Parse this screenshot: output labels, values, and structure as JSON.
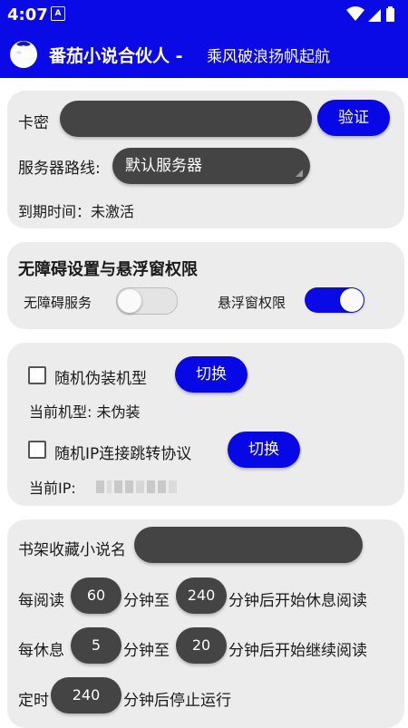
{
  "status": {
    "time": "4:07",
    "notif_icon_label": "A"
  },
  "header": {
    "title": "番茄小说合伙人 -",
    "subtitle": "乘风破浪扬帆起航"
  },
  "card1": {
    "card_key_label": "卡密",
    "card_key_value": "",
    "verify_button": "验证",
    "server_route_label": "服务器路线:",
    "server_route_value": "默认服务器",
    "expire_label": "到期时间：未激活"
  },
  "card2": {
    "title": "无障碍设置与悬浮窗权限",
    "accessibility_label": "无障碍服务",
    "accessibility_on": false,
    "overlay_label": "悬浮窗权限",
    "overlay_on": true
  },
  "card3": {
    "random_model_label": "随机伪装机型",
    "switch_button_1": "切换",
    "current_model_label": "当前机型: 未伪装",
    "random_ip_label": "随机IP连接跳转协议",
    "switch_button_2": "切换",
    "current_ip_label": "当前IP:"
  },
  "card4": {
    "shelf_label": "书架收藏小说名",
    "shelf_value": "",
    "read_prefix": "每阅读",
    "read_min_from": "60",
    "read_mid": "分钟至",
    "read_min_to": "240",
    "read_suffix": "分钟后开始休息阅读",
    "rest_prefix": "每休息",
    "rest_min_from": "5",
    "rest_mid": "分钟至",
    "rest_min_to": "20",
    "rest_suffix": "分钟后开始继续阅读",
    "timer_prefix": "定时",
    "timer_min": "240",
    "timer_suffix": "分钟后停止运行"
  },
  "colors": {
    "accent": "#0a0ae6",
    "card_bg": "#ececec",
    "pill_bg": "#444444"
  }
}
